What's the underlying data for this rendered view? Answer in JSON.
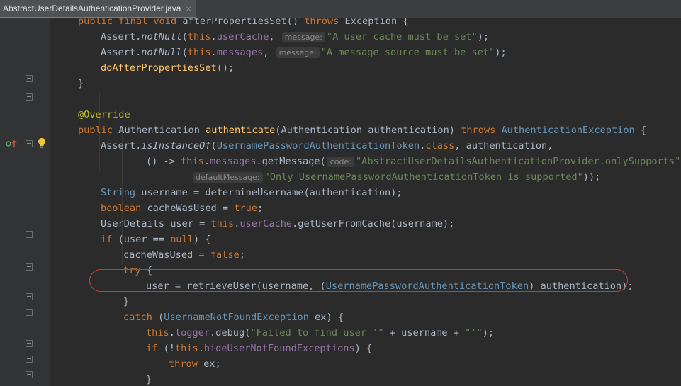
{
  "tab": {
    "file_name": "AbstractUserDetailsAuthenticationProvider.java",
    "close_glyph": "×"
  },
  "colors": {
    "keyword": "#cc7832",
    "string": "#6a8759",
    "field": "#9876aa",
    "method_decl": "#ffc66d",
    "annotation": "#bbb529",
    "type_ref": "#6897bb",
    "text": "#a9b7c6",
    "highlight_oval": "#c93a3a"
  },
  "icons": {
    "gutter_left": "overrides-method-icon",
    "bulb": "intention-bulb-icon",
    "fold": "fold-marker-icon"
  },
  "lines": [
    [
      [
        "k",
        "public "
      ],
      [
        "k",
        "final "
      ],
      [
        "k",
        "void "
      ],
      [
        "p",
        "afterPropertiesSet() "
      ],
      [
        "k",
        "throws "
      ],
      [
        "p",
        "Exception {"
      ]
    ],
    [
      [
        "p",
        "Assert."
      ],
      [
        "i",
        "notNull"
      ],
      [
        "p",
        "("
      ],
      [
        "k",
        "this"
      ],
      [
        "p",
        "."
      ],
      [
        "f",
        "userCache"
      ],
      [
        "p",
        ", "
      ],
      [
        "hint",
        "message:"
      ],
      [
        "s",
        "\"A user cache must be set\""
      ],
      [
        "p",
        ");"
      ]
    ],
    [
      [
        "p",
        "Assert."
      ],
      [
        "i",
        "notNull"
      ],
      [
        "p",
        "("
      ],
      [
        "k",
        "this"
      ],
      [
        "p",
        "."
      ],
      [
        "f",
        "messages"
      ],
      [
        "p",
        ", "
      ],
      [
        "hint",
        "message:"
      ],
      [
        "s",
        "\"A message source must be set\""
      ],
      [
        "p",
        ");"
      ]
    ],
    [
      [
        "m0",
        "doAfterPropertiesSet"
      ],
      [
        "p",
        "();"
      ]
    ],
    [
      [
        "p",
        "}"
      ]
    ],
    [],
    [
      [
        "a",
        "@Override"
      ]
    ],
    [
      [
        "k",
        "public "
      ],
      [
        "p",
        "Authentication "
      ],
      [
        "m",
        "authenticate"
      ],
      [
        "p",
        "(Authentication authentication) "
      ],
      [
        "k",
        "throws "
      ],
      [
        "t",
        "AuthenticationException "
      ],
      [
        "p",
        "{"
      ]
    ],
    [
      [
        "p",
        "Assert."
      ],
      [
        "i",
        "isInstanceOf"
      ],
      [
        "p",
        "("
      ],
      [
        "t",
        "UsernamePasswordAuthenticationToken"
      ],
      [
        "p",
        "."
      ],
      [
        "k",
        "class"
      ],
      [
        "p",
        ", authentication,"
      ]
    ],
    [
      [
        "p",
        "() -> "
      ],
      [
        "k",
        "this"
      ],
      [
        "p",
        "."
      ],
      [
        "f",
        "messages"
      ],
      [
        "p",
        ".getMessage("
      ],
      [
        "hint",
        "code:"
      ],
      [
        "s",
        "\"AbstractUserDetailsAuthenticationProvider.onlySupports\""
      ],
      [
        "p",
        ","
      ]
    ],
    [
      [
        "hint",
        "defaultMessage:"
      ],
      [
        "s",
        "\"Only UsernamePasswordAuthenticationToken is supported\""
      ],
      [
        "p",
        "));"
      ]
    ],
    [
      [
        "t",
        "String "
      ],
      [
        "p",
        "username = determineUsername(authentication);"
      ]
    ],
    [
      [
        "k",
        "boolean "
      ],
      [
        "p",
        "cacheWasUsed = "
      ],
      [
        "k",
        "true"
      ],
      [
        "p",
        ";"
      ]
    ],
    [
      [
        "p",
        "UserDetails user = "
      ],
      [
        "k",
        "this"
      ],
      [
        "p",
        "."
      ],
      [
        "f",
        "userCache"
      ],
      [
        "p",
        ".getUserFromCache(username);"
      ]
    ],
    [
      [
        "k",
        "if "
      ],
      [
        "p",
        "(user == "
      ],
      [
        "k",
        "null"
      ],
      [
        "p",
        ") {"
      ]
    ],
    [
      [
        "p",
        "cacheWasUsed = "
      ],
      [
        "k",
        "false"
      ],
      [
        "p",
        ";"
      ]
    ],
    [
      [
        "k",
        "try "
      ],
      [
        "p",
        "{"
      ]
    ],
    [
      [
        "p",
        "user = retrieveUser(username, ("
      ],
      [
        "t",
        "UsernamePasswordAuthenticationToken"
      ],
      [
        "p",
        ") authentication);"
      ]
    ],
    [
      [
        "p",
        "}"
      ]
    ],
    [
      [
        "k",
        "catch "
      ],
      [
        "p",
        "("
      ],
      [
        "t",
        "UsernameNotFoundException "
      ],
      [
        "p",
        "ex) {"
      ]
    ],
    [
      [
        "k",
        "this"
      ],
      [
        "p",
        "."
      ],
      [
        "f",
        "logger"
      ],
      [
        "p",
        ".debug("
      ],
      [
        "s",
        "\"Failed to find user '\""
      ],
      [
        "p",
        " + username + "
      ],
      [
        "s",
        "\"'\""
      ],
      [
        "p",
        ");"
      ]
    ],
    [
      [
        "k",
        "if "
      ],
      [
        "p",
        "(!"
      ],
      [
        "k",
        "this"
      ],
      [
        "p",
        "."
      ],
      [
        "f",
        "hideUserNotFoundExceptions"
      ],
      [
        "p",
        ") {"
      ]
    ],
    [
      [
        "k",
        "throw "
      ],
      [
        "p",
        "ex;"
      ]
    ],
    [
      [
        "p",
        "}"
      ]
    ]
  ]
}
